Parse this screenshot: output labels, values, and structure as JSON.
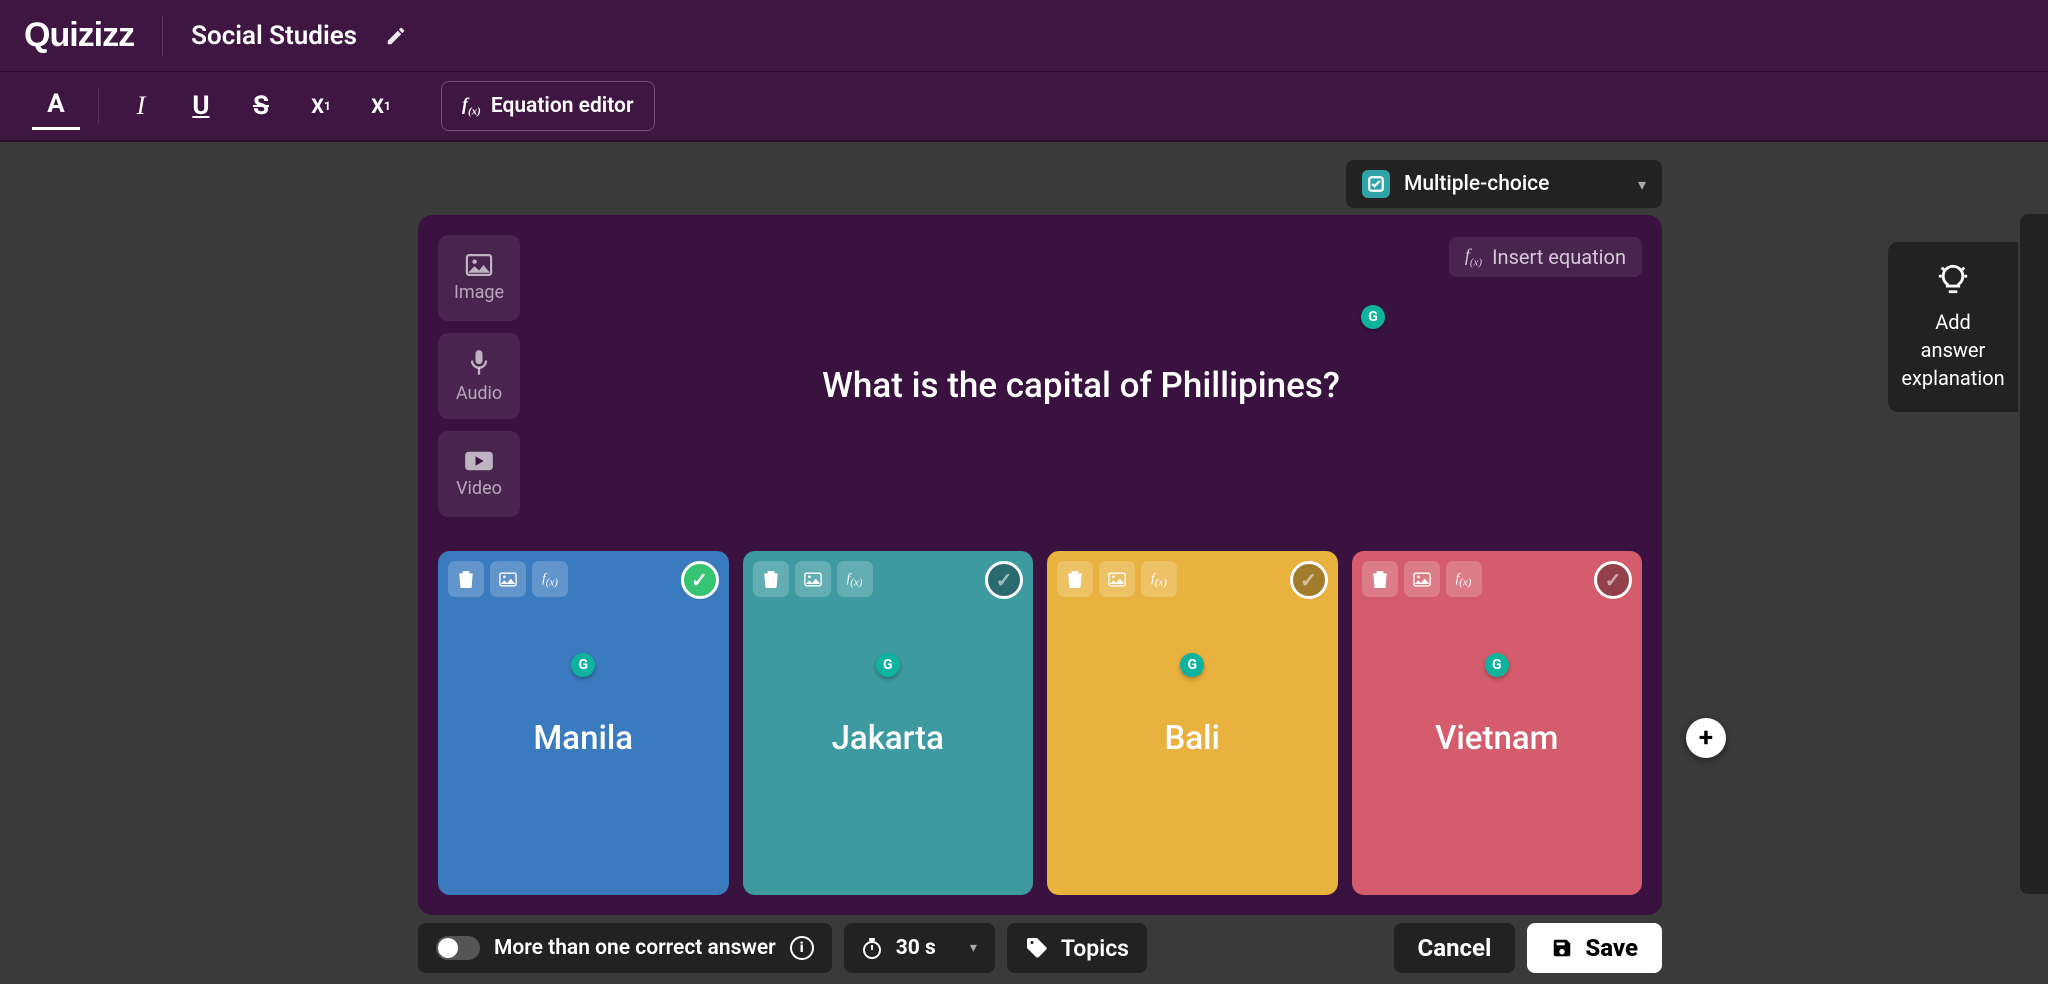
{
  "header": {
    "logo": "Quizizz",
    "title": "Social Studies"
  },
  "toolbar": {
    "equation_editor": "Equation editor"
  },
  "question_type": {
    "label": "Multiple-choice"
  },
  "media": {
    "image": "Image",
    "audio": "Audio",
    "video": "Video"
  },
  "question": {
    "insert_equation": "Insert equation",
    "text": "What is the capital of Phillipines?",
    "grammar_badge": "G"
  },
  "answers": [
    {
      "text": "Manila",
      "correct": true
    },
    {
      "text": "Jakarta",
      "correct": false
    },
    {
      "text": "Bali",
      "correct": false
    },
    {
      "text": "Vietnam",
      "correct": false
    }
  ],
  "bottom": {
    "multi_correct": "More than one correct answer",
    "time": "30 s",
    "topics": "Topics",
    "cancel": "Cancel",
    "save": "Save"
  },
  "side": {
    "explain_line1": "Add answer",
    "explain_line2": "explanation"
  }
}
